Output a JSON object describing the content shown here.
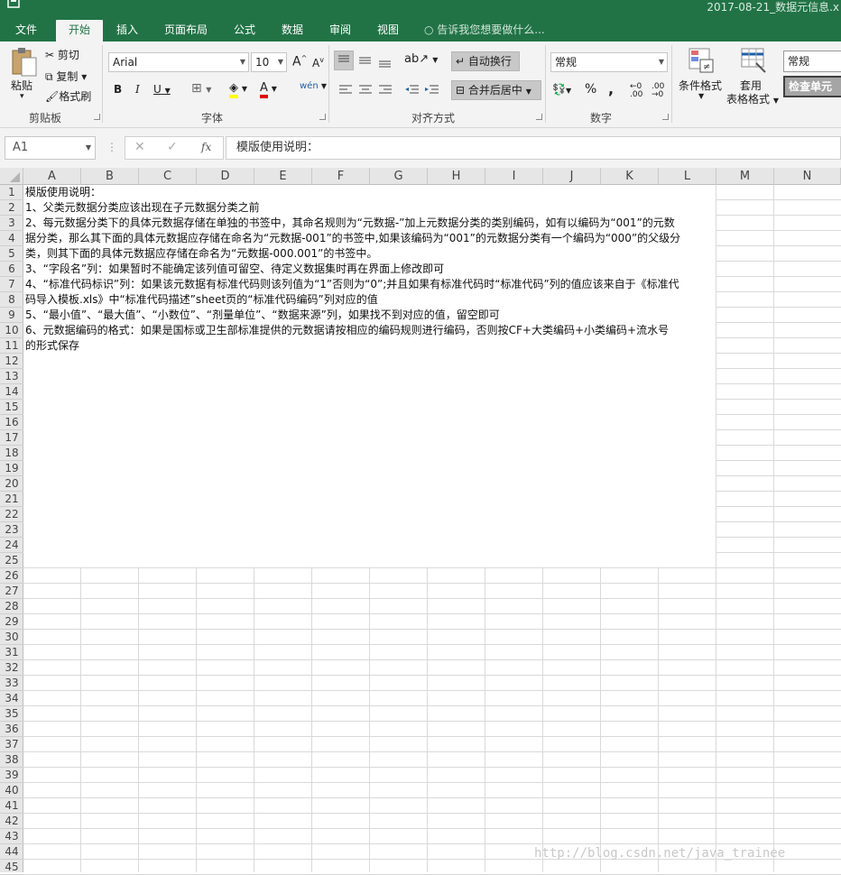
{
  "window": {
    "title": "2017-08-21_数据元信息.x"
  },
  "tabs": [
    {
      "label": "文件"
    },
    {
      "label": "开始"
    },
    {
      "label": "插入"
    },
    {
      "label": "页面布局"
    },
    {
      "label": "公式"
    },
    {
      "label": "数据"
    },
    {
      "label": "审阅"
    },
    {
      "label": "视图"
    }
  ],
  "tell_me": "告诉我您想要做什么...",
  "ribbon": {
    "clipboard": {
      "paste": "粘贴",
      "cut": "剪切",
      "copy": "复制",
      "format_painter": "格式刷",
      "group": "剪贴板"
    },
    "font": {
      "name": "Arial",
      "size": "10",
      "group": "字体",
      "bold": "B",
      "italic": "I",
      "underline": "U",
      "grow": "A",
      "shrink": "A",
      "font_color": "A",
      "wen": "wén"
    },
    "alignment": {
      "wrap": "自动换行",
      "merge": "合并后居中",
      "group": "对齐方式"
    },
    "number": {
      "format": "常规",
      "group": "数字",
      "percent": "%",
      "comma": ","
    },
    "styles": {
      "conditional": "条件格式",
      "apply_table_1": "套用",
      "apply_table_2": "表格格式",
      "style_normal": "常规",
      "check_cell": "检查单元"
    }
  },
  "formula_bar": {
    "name_box": "A1",
    "fx": "fx",
    "content": "模版使用说明："
  },
  "columns": [
    "A",
    "B",
    "C",
    "D",
    "E",
    "F",
    "G",
    "H",
    "I",
    "J",
    "K",
    "L",
    "M",
    "N"
  ],
  "row_count": 45,
  "rows": [
    "模版使用说明：",
    "1、父类元数据分类应该出现在子元数据分类之前",
    "2、每元数据分类下的具体元数据存储在单独的书签中，其命名规则为“元数据-”加上元数据分类的类别编码，如有以编码为“001”的元数",
    "据分类，那么其下面的具体元数据应存储在命名为“元数据-001”的书签中,如果该编码为“001”的元数据分类有一个编码为“000”的父级分",
    "类，则其下面的具体元数据应存储在命名为“元数据-000.001”的书签中。",
    "3、“字段名”列：如果暂时不能确定该列值可留空、待定义数据集时再在界面上修改即可",
    "4、“标准代码标识”列：如果该元数据有标准代码则该列值为“1”否则为“0”;并且如果有标准代码时“标准代码”列的值应该来自于《标准代",
    "码导入模板.xls》中“标准代码描述”sheet页的“标准代码编码”列对应的值",
    "5、“最小值”、“最大值”、“小数位”、“剂量单位”、“数据来源”列，如果找不到对应的值，留空即可",
    "6、元数据编码的格式：如果是国标或卫生部标准提供的元数据请按相应的编码规则进行编码，否则按CF+大类编码+小类编码+流水号",
    "的形式保存"
  ],
  "watermark": "http://blog.csdn.net/java_trainee"
}
